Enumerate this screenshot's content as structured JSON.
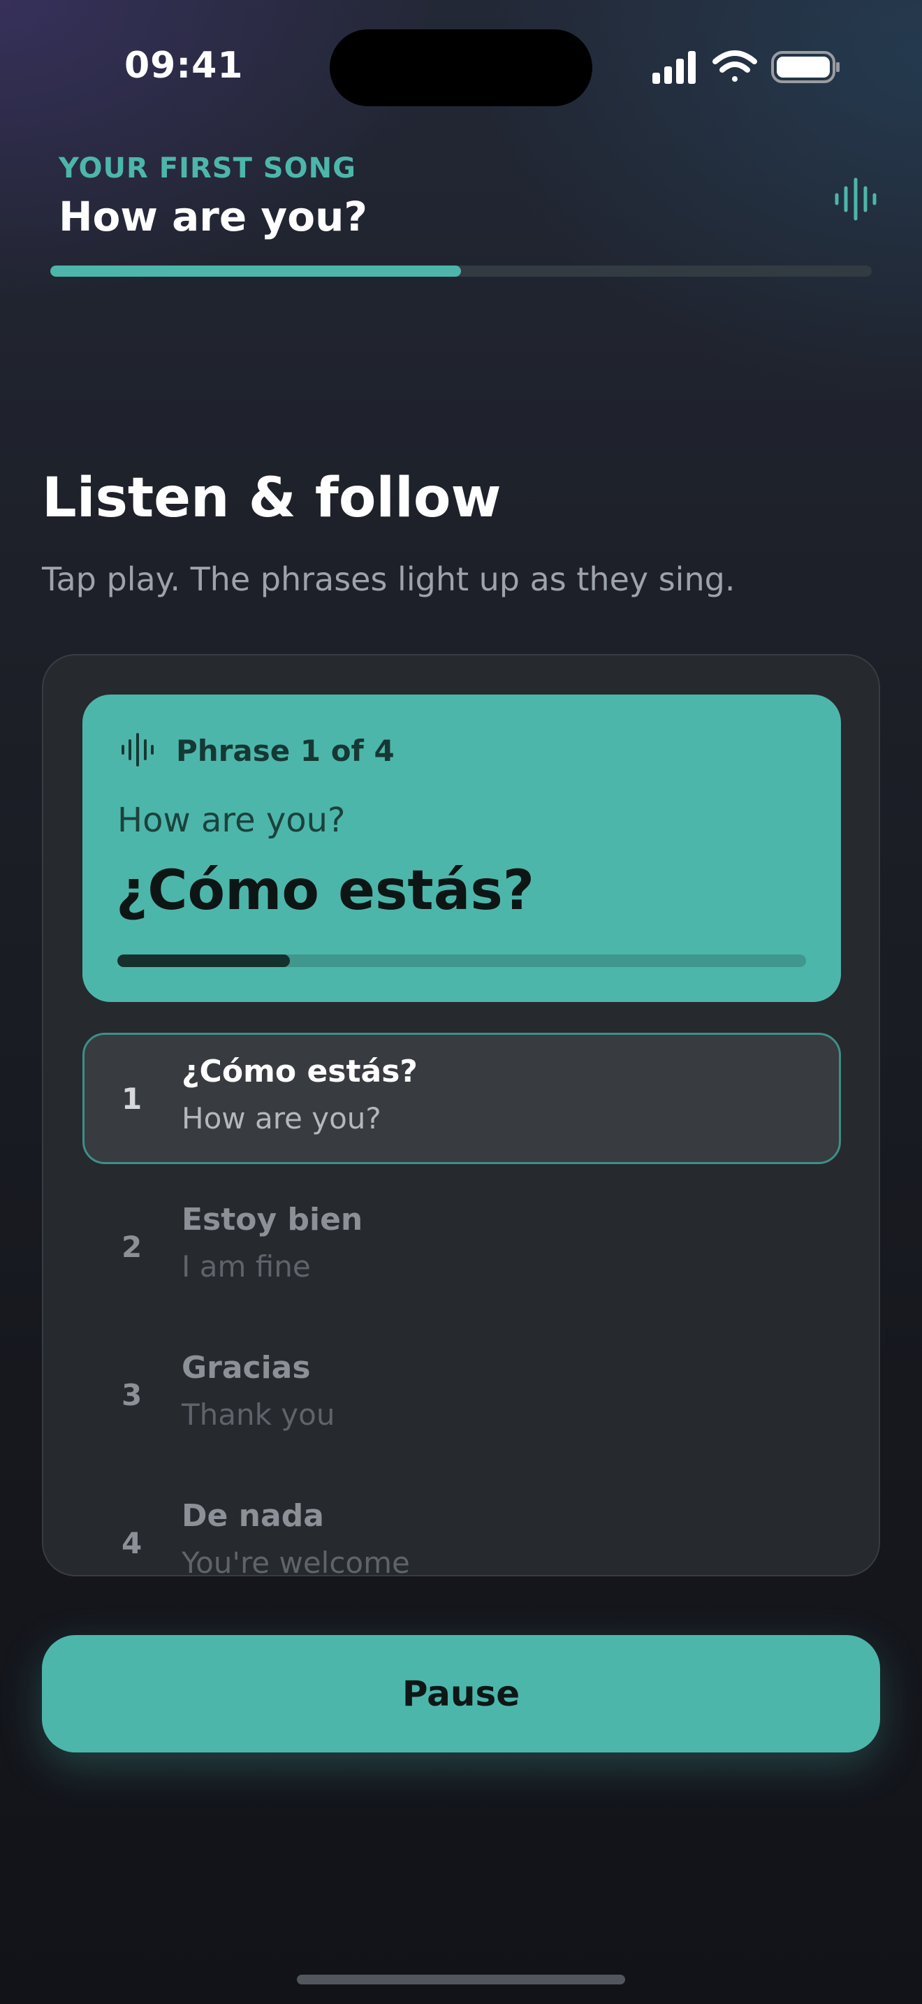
{
  "status_bar": {
    "time": "09:41"
  },
  "header": {
    "eyebrow": "YOUR FIRST SONG",
    "title": "How are you?",
    "song_progress": 0.5
  },
  "section": {
    "title": "Listen & follow",
    "subtitle": "Tap play. The phrases light up as they sing."
  },
  "current_phrase": {
    "counter": "Phrase 1 of 4",
    "translation": "How are you?",
    "original": "¿Cómo estás?",
    "progress": 0.25
  },
  "phrases": [
    {
      "index": "1",
      "text": "¿Cómo estás?",
      "translation": "How are you?",
      "active": true
    },
    {
      "index": "2",
      "text": "Estoy bien",
      "translation": "I am fine",
      "active": false
    },
    {
      "index": "3",
      "text": "Gracias",
      "translation": "Thank you",
      "active": false
    },
    {
      "index": "4",
      "text": "De nada",
      "translation": "You're welcome",
      "active": false
    }
  ],
  "controls": {
    "pause_label": "Pause"
  },
  "colors": {
    "accent": "#4db6ab",
    "background": "#16181e",
    "card": "#26292e"
  },
  "icons": {
    "status": [
      "cellular-signal-icon",
      "wifi-icon",
      "battery-icon"
    ],
    "header": "audio-wave-icon",
    "phrase": "audio-wave-icon"
  }
}
